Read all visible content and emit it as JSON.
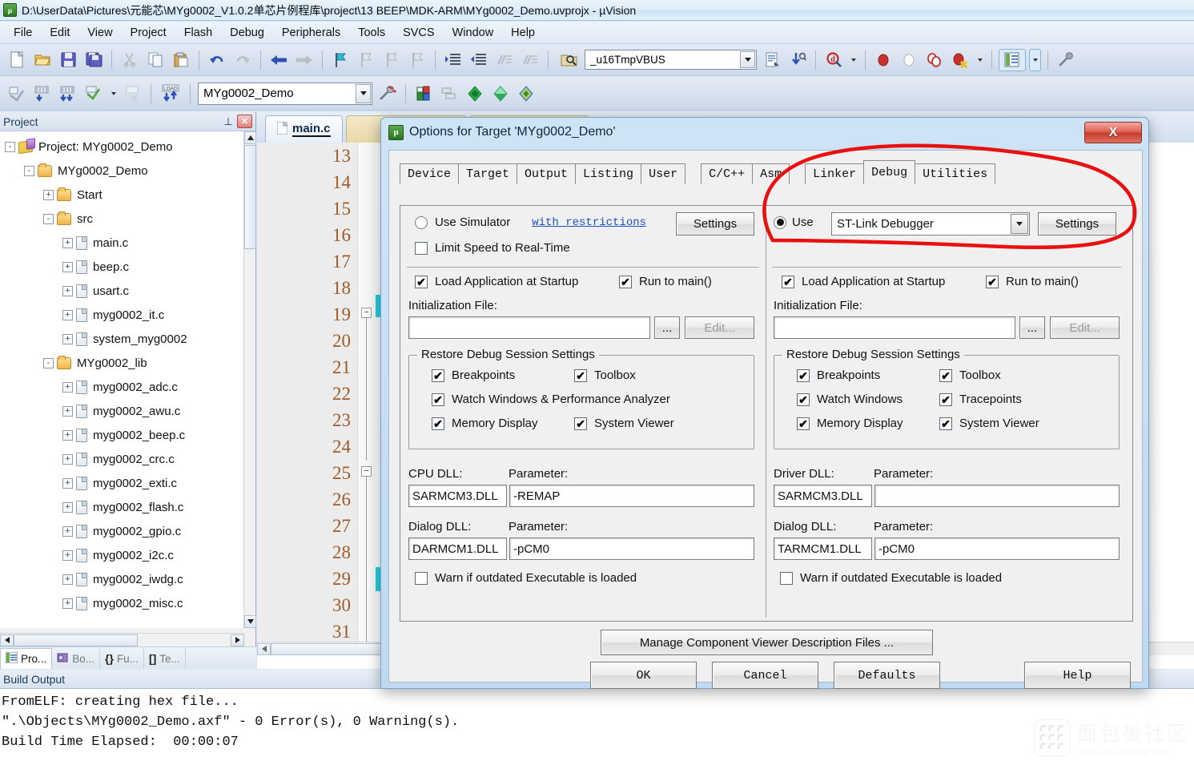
{
  "window": {
    "title": "D:\\UserData\\Pictures\\元能芯\\MYg0002_V1.0.2单芯片例程库\\project\\13 BEEP\\MDK-ARM\\MYg0002_Demo.uvprojx - µVision",
    "app_icon": "uvision-icon"
  },
  "menubar": {
    "items": [
      "File",
      "Edit",
      "View",
      "Project",
      "Flash",
      "Debug",
      "Peripherals",
      "Tools",
      "SVCS",
      "Window",
      "Help"
    ]
  },
  "toolbar1": {
    "buttons": [
      "new-file-icon",
      "open-file-icon",
      "save-icon",
      "save-all-icon",
      "cut-icon",
      "copy-icon",
      "paste-icon",
      "undo-icon",
      "redo-icon",
      "navigate-back-icon",
      "navigate-forward-icon",
      "bookmark-toggle-icon",
      "bookmark-prev-icon",
      "bookmark-next-icon",
      "bookmark-clear-icon",
      "indent-icon",
      "outdent-icon",
      "comment-icon",
      "uncomment-icon"
    ]
  },
  "toolbar1_right": {
    "find_icon": "find-in-files-icon",
    "search_value": "_u16TmpVBUS",
    "buttons": [
      "text-browse-icon",
      "find-next-icon",
      "debug-query-icon",
      "insert-breakpoint-icon",
      "disable-breakpoint-icon",
      "disable-all-breakpoints-icon",
      "kill-all-breakpoints-icon",
      "window-layout-icon",
      "configure-icon"
    ]
  },
  "toolbar2": {
    "buttons": [
      "translate-icon",
      "build-icon",
      "rebuild-icon",
      "batch-build-icon",
      "stop-build-icon",
      "download-icon"
    ],
    "target_value": "MYg0002_Demo",
    "right_buttons": [
      "target-options-icon",
      "manage-components-icon",
      "multi-project-icon",
      "pack-installer-icon",
      "manage-runtime-icon",
      "pack-manage-icon"
    ]
  },
  "project_panel": {
    "title": "Project",
    "pin_icon": "pin-icon",
    "close_icon": "close-icon",
    "tree": [
      {
        "label": "Project: MYg0002_Demo",
        "depth": 0,
        "expander": "-",
        "icon": "project-icon"
      },
      {
        "label": "MYg0002_Demo",
        "depth": 1,
        "expander": "-",
        "icon": "target-folder-icon"
      },
      {
        "label": "Start",
        "depth": 2,
        "expander": "+",
        "icon": "folder-icon"
      },
      {
        "label": "src",
        "depth": 2,
        "expander": "-",
        "icon": "folder-icon"
      },
      {
        "label": "main.c",
        "depth": 3,
        "expander": "+",
        "icon": "c-file-icon"
      },
      {
        "label": "beep.c",
        "depth": 3,
        "expander": "+",
        "icon": "c-file-icon"
      },
      {
        "label": "usart.c",
        "depth": 3,
        "expander": "+",
        "icon": "c-file-icon"
      },
      {
        "label": "myg0002_it.c",
        "depth": 3,
        "expander": "+",
        "icon": "c-file-icon"
      },
      {
        "label": "system_myg0002",
        "depth": 3,
        "expander": "+",
        "icon": "c-file-icon"
      },
      {
        "label": "MYg0002_lib",
        "depth": 2,
        "expander": "-",
        "icon": "folder-icon"
      },
      {
        "label": "myg0002_adc.c",
        "depth": 3,
        "expander": "+",
        "icon": "c-file-icon"
      },
      {
        "label": "myg0002_awu.c",
        "depth": 3,
        "expander": "+",
        "icon": "c-file-icon"
      },
      {
        "label": "myg0002_beep.c",
        "depth": 3,
        "expander": "+",
        "icon": "c-file-icon"
      },
      {
        "label": "myg0002_crc.c",
        "depth": 3,
        "expander": "+",
        "icon": "c-file-icon"
      },
      {
        "label": "myg0002_exti.c",
        "depth": 3,
        "expander": "+",
        "icon": "c-file-icon"
      },
      {
        "label": "myg0002_flash.c",
        "depth": 3,
        "expander": "+",
        "icon": "c-file-icon"
      },
      {
        "label": "myg0002_gpio.c",
        "depth": 3,
        "expander": "+",
        "icon": "c-file-icon"
      },
      {
        "label": "myg0002_i2c.c",
        "depth": 3,
        "expander": "+",
        "icon": "c-file-icon"
      },
      {
        "label": "myg0002_iwdg.c",
        "depth": 3,
        "expander": "+",
        "icon": "c-file-icon"
      },
      {
        "label": "myg0002_misc.c",
        "depth": 3,
        "expander": "+",
        "icon": "c-file-icon"
      }
    ],
    "tabs": [
      {
        "label": "Pro...",
        "icon": "project-tab-icon",
        "active": true
      },
      {
        "label": "Bo...",
        "icon": "books-tab-icon",
        "active": false
      },
      {
        "label": "Fu...",
        "icon": "functions-tab-icon",
        "active": false
      },
      {
        "label": "Te...",
        "icon": "templates-tab-icon",
        "active": false
      }
    ]
  },
  "editor": {
    "tabs": [
      {
        "label": "main.c",
        "icon": "c-file-icon",
        "active": true
      }
    ],
    "line_numbers": [
      "13",
      "14",
      "15",
      "16",
      "17",
      "18",
      "19",
      "20",
      "21",
      "22",
      "23",
      "24",
      "25",
      "26",
      "27",
      "28",
      "29",
      "30",
      "31"
    ]
  },
  "build_output": {
    "title": "Build Output",
    "lines": [
      "FromELF: creating hex file...",
      "\".\\Objects\\MYg0002_Demo.axf\" - 0 Error(s), 0 Warning(s).",
      "Build Time Elapsed:  00:00:07"
    ]
  },
  "dialog": {
    "title": "Options for Target 'MYg0002_Demo'",
    "icon": "uvision-icon",
    "close_label": "X",
    "tabs": [
      {
        "label": "Device",
        "active": false
      },
      {
        "label": "Target",
        "active": false
      },
      {
        "label": "Output",
        "active": false
      },
      {
        "label": "Listing",
        "active": false
      },
      {
        "label": "User",
        "active": false
      },
      {
        "label": "C/C++",
        "active": false
      },
      {
        "label": "Asm",
        "active": false
      },
      {
        "label": "Linker",
        "active": false
      },
      {
        "label": "Debug",
        "active": true
      },
      {
        "label": "Utilities",
        "active": false
      }
    ],
    "left": {
      "use_simulator_label": "Use Simulator",
      "use_simulator_checked": false,
      "restrictions_link": "with restrictions",
      "settings_label": "Settings",
      "limit_speed_label": "Limit Speed to Real-Time",
      "limit_speed_checked": false,
      "load_app_label": "Load Application at Startup",
      "load_app_checked": true,
      "run_to_main_label": "Run to main()",
      "run_to_main_checked": true,
      "init_file_label": "Initialization File:",
      "init_file_value": "",
      "browse_label": "...",
      "edit_label": "Edit...",
      "restore_group_title": "Restore Debug Session Settings",
      "restore_items": [
        {
          "label": "Breakpoints",
          "checked": true
        },
        {
          "label": "Toolbox",
          "checked": true
        },
        {
          "label": "Watch Windows & Performance Analyzer",
          "checked": true
        },
        {
          "label": "Memory Display",
          "checked": true
        },
        {
          "label": "System Viewer",
          "checked": true
        }
      ],
      "cpu_dll_label": "CPU DLL:",
      "cpu_dll_value": "SARMCM3.DLL",
      "cpu_param_label": "Parameter:",
      "cpu_param_value": "-REMAP",
      "dialog_dll_label": "Dialog DLL:",
      "dialog_dll_value": "DARMCM1.DLL",
      "dialog_param_label": "Parameter:",
      "dialog_param_value": "-pCM0",
      "warn_label": "Warn if outdated Executable is loaded",
      "warn_checked": false
    },
    "right": {
      "use_label": "Use",
      "use_checked": true,
      "debugger_value": "ST-Link Debugger",
      "settings_label": "Settings",
      "load_app_label": "Load Application at Startup",
      "load_app_checked": true,
      "run_to_main_label": "Run to main()",
      "run_to_main_checked": true,
      "init_file_label": "Initialization File:",
      "init_file_value": "",
      "browse_label": "...",
      "edit_label": "Edit...",
      "restore_group_title": "Restore Debug Session Settings",
      "restore_items": [
        {
          "label": "Breakpoints",
          "checked": true
        },
        {
          "label": "Toolbox",
          "checked": true
        },
        {
          "label": "Watch Windows",
          "checked": true
        },
        {
          "label": "Tracepoints",
          "checked": true
        },
        {
          "label": "Memory Display",
          "checked": true
        },
        {
          "label": "System Viewer",
          "checked": true
        }
      ],
      "driver_dll_label": "Driver DLL:",
      "driver_dll_value": "SARMCM3.DLL",
      "driver_param_label": "Parameter:",
      "driver_param_value": "",
      "dialog_dll_label": "Dialog DLL:",
      "dialog_dll_value": "TARMCM1.DLL",
      "dialog_param_label": "Parameter:",
      "dialog_param_value": "-pCM0",
      "warn_label": "Warn if outdated Executable is loaded",
      "warn_checked": false
    },
    "manage_button": "Manage Component Viewer Description Files ...",
    "footer": {
      "ok": "OK",
      "cancel": "Cancel",
      "defaults": "Defaults",
      "help": "Help"
    }
  },
  "annotation": {
    "color": "#e8110f",
    "shape": "ellipse-highlight-around-debugger-selection"
  },
  "watermark": {
    "cn": "面包板社区",
    "en": "mbb.eet-china.com"
  }
}
